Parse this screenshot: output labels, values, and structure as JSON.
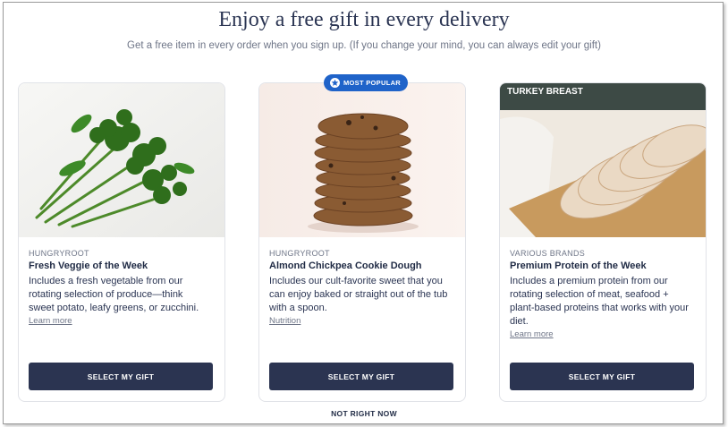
{
  "header": {
    "title": "Enjoy a free gift in every delivery",
    "subtitle": "Get a free item in every order when you sign up. (If you change your mind, you can always edit your gift)"
  },
  "badge": {
    "label": "MOST POPULAR",
    "icon": "star-icon",
    "color": "#1f63c9"
  },
  "cards": [
    {
      "brand": "HUNGRYROOT",
      "name": "Fresh Veggie of the Week",
      "desc_lines": [
        "Includes a fresh vegetable from our",
        "rotating selection of produce—think",
        "sweet potato, leafy greens, or zucchini."
      ],
      "link": "Learn more",
      "button": "SELECT MY GIFT"
    },
    {
      "brand": "HUNGRYROOT",
      "name": "Almond Chickpea Cookie Dough",
      "desc_lines": [
        "Includes our cult-favorite sweet that you",
        "can enjoy baked or straight out of the tub",
        "with a spoon."
      ],
      "link": "Nutrition",
      "button": "SELECT MY GIFT"
    },
    {
      "brand": "VARIOUS BRANDS",
      "name": "Premium Protein of the Week",
      "desc_lines": [
        "Includes a premium protein from our",
        "rotating selection of meat, seafood +",
        "plant-based proteins that works with your",
        "diet."
      ],
      "link": "Learn more",
      "button": "SELECT MY GIFT",
      "image_text": "TURKEY BREAST"
    }
  ],
  "footer": {
    "skip": "NOT RIGHT NOW"
  },
  "colors": {
    "button": "#2b3451",
    "text": "#1f2a44",
    "muted": "#6e7587"
  }
}
